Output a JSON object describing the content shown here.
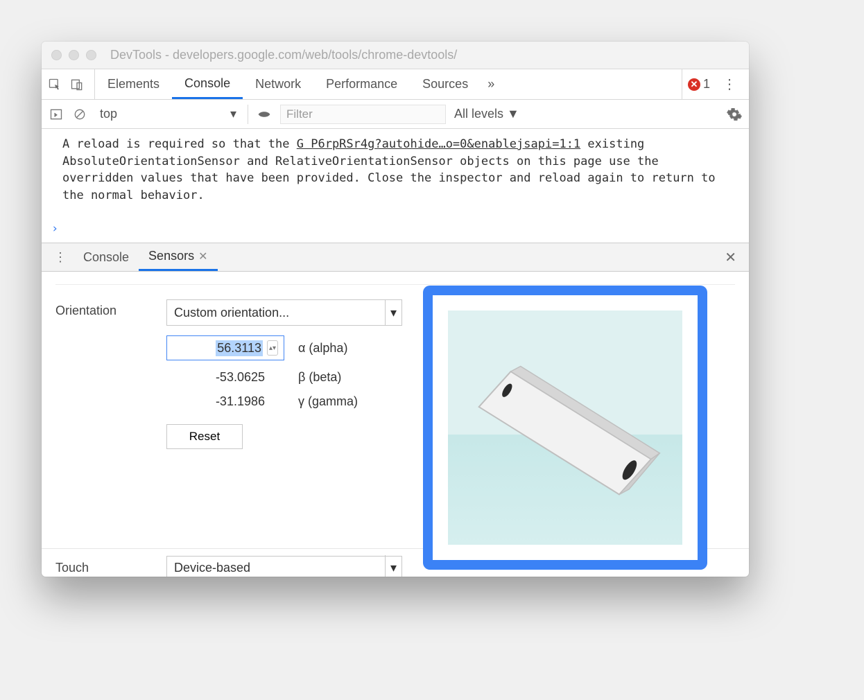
{
  "window": {
    "title": "DevTools - developers.google.com/web/tools/chrome-devtools/"
  },
  "mainTabs": {
    "items": [
      "Elements",
      "Console",
      "Network",
      "Performance",
      "Sources"
    ],
    "overflow": "»",
    "active": "Console",
    "errorCount": "1"
  },
  "consoleToolbar": {
    "context": "top",
    "filterPlaceholder": "Filter",
    "levels": "All levels ▼"
  },
  "consoleMessage": {
    "textBefore": "A reload is required so that the ",
    "link": "G P6rpRSr4g?autohide…o=0&enablejsapi=1:1",
    "textAfter": " existing AbsoluteOrientationSensor and RelativeOrientationSensor objects on this page use the overridden values that have been provided. Close the inspector and reload again to return to the normal behavior."
  },
  "prompt": "›",
  "drawer": {
    "tabs": [
      "Console",
      "Sensors"
    ],
    "active": "Sensors"
  },
  "sensors": {
    "orientation": {
      "label": "Orientation",
      "preset": "Custom orientation...",
      "alpha": {
        "value": "56.3113",
        "label": "α (alpha)"
      },
      "beta": {
        "value": "-53.0625",
        "label": "β (beta)"
      },
      "gamma": {
        "value": "-31.1986",
        "label": "γ (gamma)"
      },
      "resetLabel": "Reset"
    },
    "touch": {
      "label": "Touch",
      "preset": "Device-based"
    }
  }
}
